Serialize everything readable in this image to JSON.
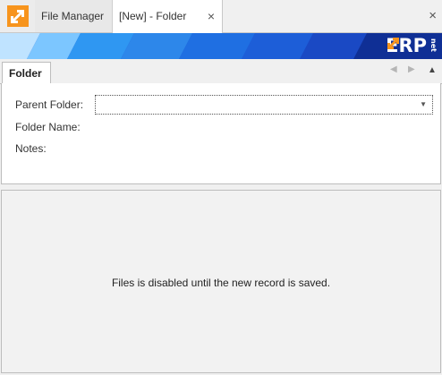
{
  "tabs": {
    "file_manager": "File Manager",
    "new_folder": "[New] - Folder",
    "close_glyph": "×"
  },
  "window": {
    "close_glyph": "×"
  },
  "brand": {
    "logo_text": "ERP",
    "logo_suffix": "net",
    "colors": {
      "orange": "#f7941d",
      "blue": "#1f5bd6",
      "dark_blue": "#0d2c8c",
      "light_blue": "#4fb3ff"
    }
  },
  "panel": {
    "tab_label": "Folder",
    "nav_prev": "◀",
    "nav_next": "▶",
    "collapse": "▲"
  },
  "form": {
    "parent_folder_label": "Parent Folder:",
    "parent_folder_value": "",
    "folder_name_label": "Folder Name:",
    "notes_label": "Notes:",
    "dropdown_glyph": "▼"
  },
  "files": {
    "message": "Files is disabled until the new record is saved."
  }
}
